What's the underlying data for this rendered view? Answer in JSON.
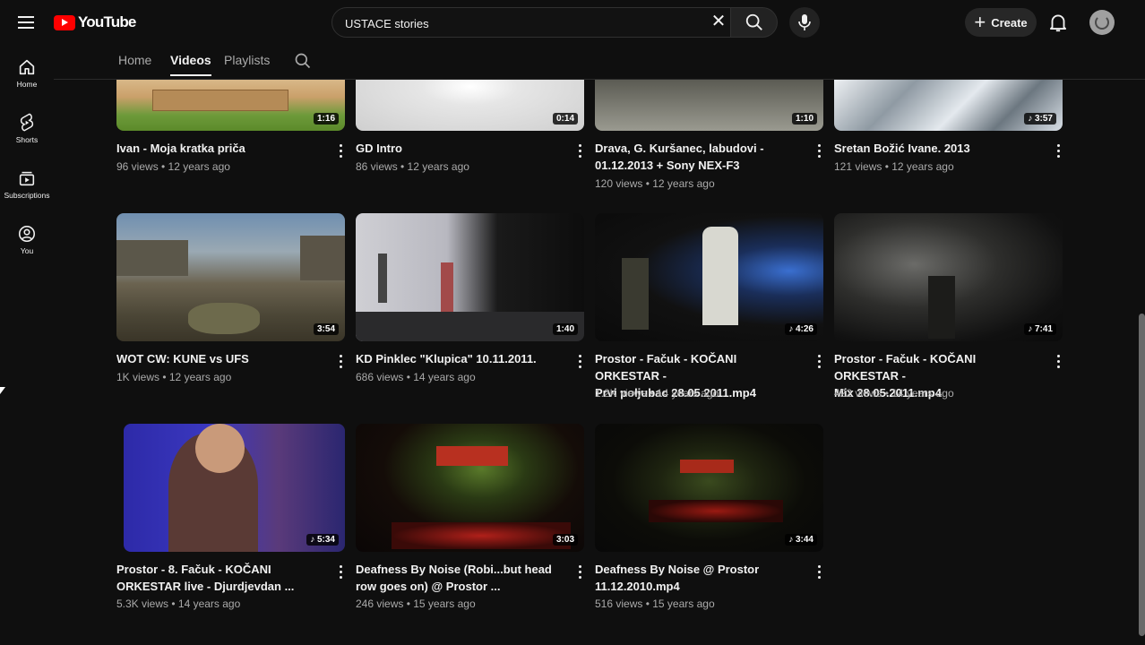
{
  "header": {
    "logo_text": "YouTube",
    "search_value": "USTACE stories",
    "create_label": "Create"
  },
  "sidebar": {
    "items": [
      {
        "label": "Home",
        "icon": "home-icon"
      },
      {
        "label": "Shorts",
        "icon": "shorts-icon"
      },
      {
        "label": "Subscriptions",
        "icon": "subscriptions-icon"
      },
      {
        "label": "You",
        "icon": "you-icon"
      }
    ]
  },
  "tabs": [
    {
      "label": "Home"
    },
    {
      "label": "Videos",
      "active": true
    },
    {
      "label": "Playlists"
    }
  ],
  "videos": [
    {
      "title_line1": "Ivan - Moja kratka priča",
      "title_line2": "",
      "meta": "96 views • 12 years ago",
      "duration": "1:16"
    },
    {
      "title_line1": "GD Intro",
      "title_line2": "",
      "meta": "86 views • 12 years ago",
      "duration": "0:14"
    },
    {
      "title_line1": "Drava, G. Kuršanec, labudovi -",
      "title_line2": "01.12.2013 + Sony NEX-F3",
      "meta": "120 views • 12 years ago",
      "duration": "1:10"
    },
    {
      "title_line1": "Sretan Božić Ivane. 2013",
      "title_line2": "",
      "meta": "121 views • 12 years ago",
      "duration": "♪ 3:57"
    },
    {
      "title_line1": "WOT CW: KUNE vs UFS",
      "title_line2": "",
      "meta": "1K views • 12 years ago",
      "duration": "3:54"
    },
    {
      "title_line1": "KD Pinklec \"Klupica\" 10.11.2011.",
      "title_line2": "",
      "meta": "686 views • 14 years ago",
      "duration": "1:40"
    },
    {
      "title_line1": "Prostor - Fačuk - KOČANI ORKESTAR -",
      "title_line2": "Prvi poljubac 28.05.2011.mp4",
      "meta": "1.2K views • 14 years ago",
      "duration": "♪ 4:26"
    },
    {
      "title_line1": "Prostor - Fačuk - KOČANI ORKESTAR -",
      "title_line2": "Mix 28.05.2011.mp4",
      "meta": "422 views • 14 years ago",
      "duration": "♪ 7:41"
    },
    {
      "title_line1": "Prostor - 8. Fačuk - KOČANI",
      "title_line2": "ORKESTAR live - Djurdjevdan ...",
      "meta": "5.3K views • 14 years ago",
      "duration": "♪ 5:34"
    },
    {
      "title_line1": "Deafness By Noise  (Robi...but head",
      "title_line2": "row goes on) @ Prostor ...",
      "meta": "246 views • 15 years ago",
      "duration": "3:03"
    },
    {
      "title_line1": "Deafness By Noise @ Prostor",
      "title_line2": "11.12.2010.mp4",
      "meta": "516 views • 15 years ago",
      "duration": "♪ 3:44"
    }
  ],
  "colors": {
    "background": "#0f0f0f",
    "accent": "#ff0000",
    "text": "#f1f1f1",
    "secondary_text": "#aaaaaa"
  }
}
